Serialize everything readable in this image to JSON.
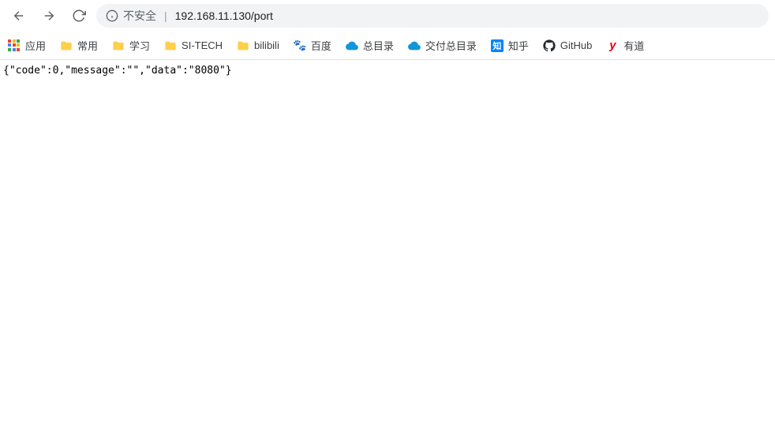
{
  "toolbar": {
    "insecure_label": "不安全",
    "url": "192.168.11.130/port"
  },
  "bookmarks": {
    "apps_label": "应用",
    "items": [
      {
        "label": "常用",
        "icon": "folder"
      },
      {
        "label": "学习",
        "icon": "folder"
      },
      {
        "label": "SI-TECH",
        "icon": "folder"
      },
      {
        "label": "bilibili",
        "icon": "folder"
      },
      {
        "label": "百度",
        "icon": "baidu"
      },
      {
        "label": "总目录",
        "icon": "cloud"
      },
      {
        "label": "交付总目录",
        "icon": "cloud"
      },
      {
        "label": "知乎",
        "icon": "zhihu"
      },
      {
        "label": "GitHub",
        "icon": "github"
      },
      {
        "label": "有道",
        "icon": "youdao"
      }
    ]
  },
  "page_body": "{\"code\":0,\"message\":\"\",\"data\":\"8080\"}",
  "apps_colors": [
    "#ea4335",
    "#fbbc05",
    "#34a853",
    "#4285f4",
    "#ea4335",
    "#fbbc05",
    "#34a853",
    "#4285f4",
    "#ea4335"
  ]
}
